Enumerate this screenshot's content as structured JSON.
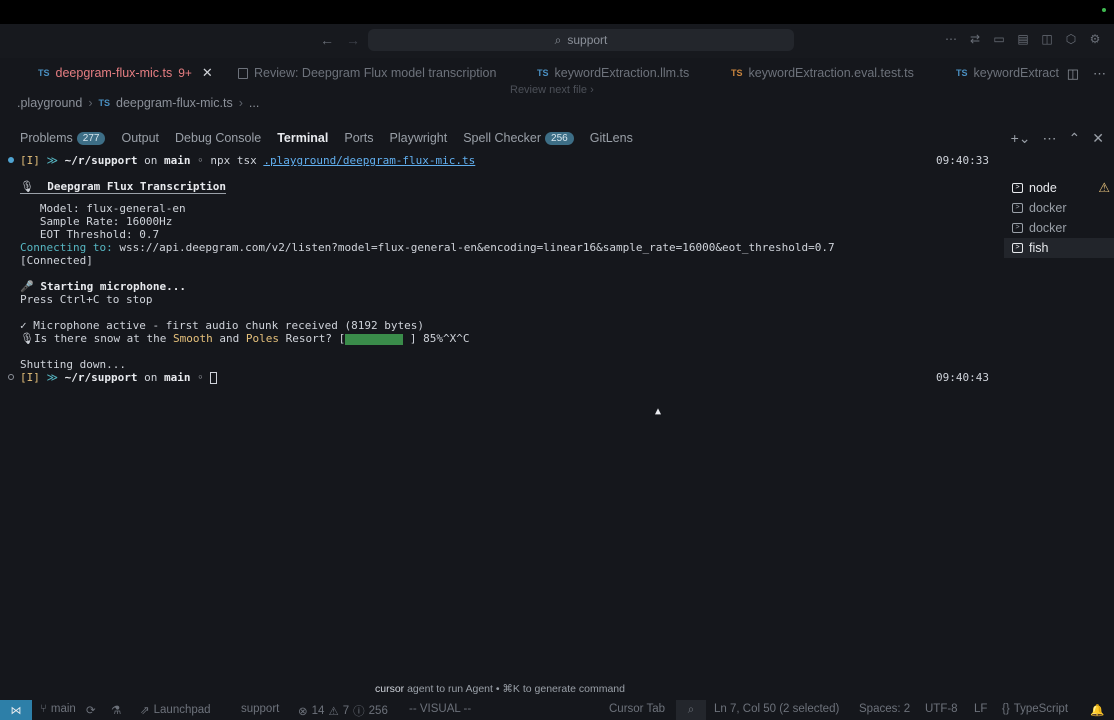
{
  "titlebar": {
    "search_text": "support"
  },
  "tabs": [
    {
      "lang": "TS",
      "name": "deepgram-flux-mic.ts",
      "badge": "9+",
      "active": true
    },
    {
      "lang": "",
      "name": "Review: Deepgram Flux model transcription",
      "active": false
    },
    {
      "lang": "TS",
      "name": "keywordExtraction.llm.ts",
      "active": false
    },
    {
      "lang": "TS",
      "name": "keywordExtraction.eval.test.ts",
      "active": false
    },
    {
      "lang": "TS",
      "name": "keywordExtract",
      "active": false
    }
  ],
  "review_hint": "Review next file",
  "breadcrumb": {
    "folder": ".playground",
    "lang": "TS",
    "file": "deepgram-flux-mic.ts",
    "more": "..."
  },
  "panel_tabs": [
    {
      "label": "Problems",
      "count": "277"
    },
    {
      "label": "Output"
    },
    {
      "label": "Debug Console"
    },
    {
      "label": "Terminal",
      "active": true
    },
    {
      "label": "Ports"
    },
    {
      "label": "Playwright"
    },
    {
      "label": "Spell Checker",
      "count": "256"
    },
    {
      "label": "GitLens"
    }
  ],
  "terminal": {
    "prompt1": {
      "mode": "[I]",
      "arrows": "≫",
      "path": "~/r/support",
      "on": "on",
      "branch": "main",
      "dot": "◦",
      "cmd": "npx tsx",
      "file": ".playground/deepgram-flux-mic.ts",
      "time": "09:40:33"
    },
    "header": "Deepgram Flux Transcription",
    "header_icon": "🎙",
    "model": "   Model: flux-general-en",
    "sample_rate": "   Sample Rate: 16000Hz",
    "eot": "   EOT Threshold: 0.7",
    "connecting_label": "Connecting to:",
    "connecting_url": " wss://api.deepgram.com/v2/listen?model=flux-general-en&encoding=linear16&sample_rate=16000&eot_threshold=0.7",
    "connected": "[Connected]",
    "mic_icon": "🎤",
    "starting": "Starting microphone...",
    "press": "Press Ctrl+C to stop",
    "mic_active": "✓ Microphone active - first audio chunk received (8192 bytes)",
    "transcript_icon": "🎙",
    "transcript_pre": "Is there snow at the ",
    "word_smooth": "Smooth",
    "word_and": " and ",
    "word_poles": "Poles",
    "transcript_post": " Resort? [",
    "progress_end": " ] 85%^X^C",
    "progress_value": 85,
    "shutting": "Shutting down...",
    "prompt2": {
      "mode": "[I]",
      "arrows": "≫",
      "path": "~/r/support",
      "on": "on",
      "branch": "main",
      "dot": "◦",
      "time": "09:40:43"
    }
  },
  "terminal_list": [
    {
      "name": "node",
      "warn": true
    },
    {
      "name": "docker"
    },
    {
      "name": "docker"
    },
    {
      "name": "fish",
      "active": true
    }
  ],
  "agent_hint": {
    "pre": "cursor",
    "rest": " agent to run Agent • ⌘K to generate command"
  },
  "statusbar": {
    "branch": "main",
    "launchpad": "Launchpad",
    "workspace": "support",
    "errors": "14",
    "warnings": "7",
    "info": "256",
    "mode": "-- VISUAL --",
    "cursor_tab": "Cursor Tab",
    "position": "Ln 7, Col 50 (2 selected)",
    "spaces": "Spaces: 2",
    "encoding": "UTF-8",
    "eol": "LF",
    "language": "TypeScript"
  },
  "colors": {
    "accent": "#2d7fa8",
    "modified_tab": "#e67e82",
    "progress": "#3a8c4a",
    "badge": "#3d6e86"
  }
}
